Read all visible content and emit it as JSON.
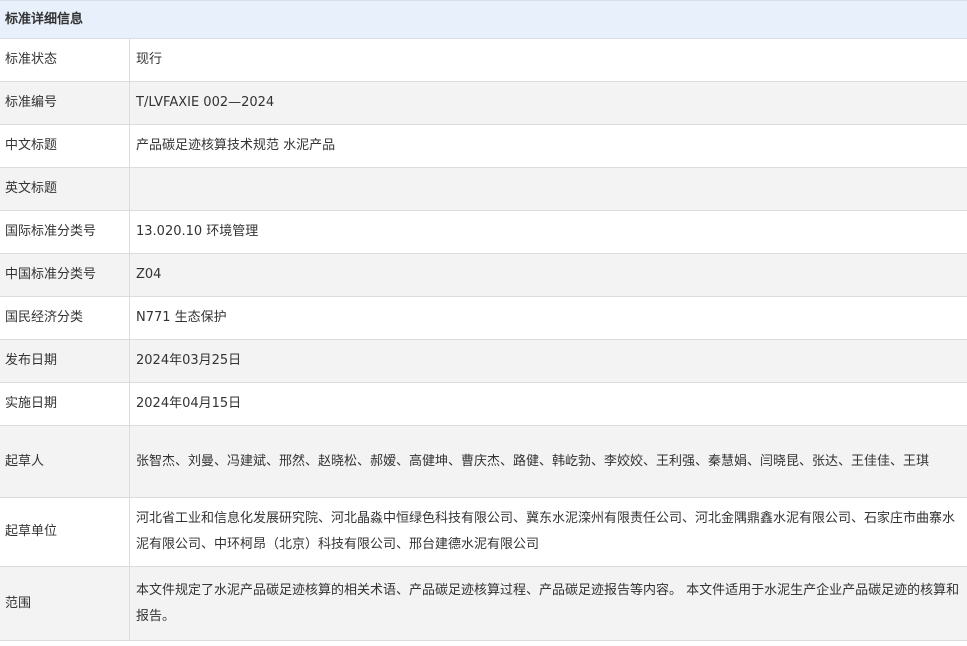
{
  "header": {
    "title": "标准详细信息"
  },
  "rows": [
    {
      "label": "标准状态",
      "value": "现行"
    },
    {
      "label": "标准编号",
      "value": "T/LVFAXIE 002—2024"
    },
    {
      "label": "中文标题",
      "value": "产品碳足迹核算技术规范 水泥产品"
    },
    {
      "label": "英文标题",
      "value": ""
    },
    {
      "label": "国际标准分类号",
      "value": "13.020.10 环境管理"
    },
    {
      "label": "中国标准分类号",
      "value": "Z04"
    },
    {
      "label": "国民经济分类",
      "value": "N771 生态保护"
    },
    {
      "label": "发布日期",
      "value": "2024年03月25日"
    },
    {
      "label": "实施日期",
      "value": "2024年04月15日"
    },
    {
      "label": "起草人",
      "value": "张智杰、刘曼、冯建斌、邢然、赵晓松、郝嫒、高健坤、曹庆杰、路健、韩屹勃、李姣姣、王利强、秦慧娟、闫晓昆、张达、王佳佳、王琪"
    },
    {
      "label": "起草单位",
      "value": "河北省工业和信息化发展研究院、河北晶淼中恒绿色科技有限公司、冀东水泥滦州有限责任公司、河北金隅鼎鑫水泥有限公司、石家庄市曲寨水泥有限公司、中环柯昂（北京）科技有限公司、邢台建德水泥有限公司"
    },
    {
      "label": "范围",
      "value": "本文件规定了水泥产品碳足迹核算的相关术语、产品碳足迹核算过程、产品碳足迹报告等内容。 本文件适用于水泥生产企业产品碳足迹的核算和报告。"
    }
  ]
}
